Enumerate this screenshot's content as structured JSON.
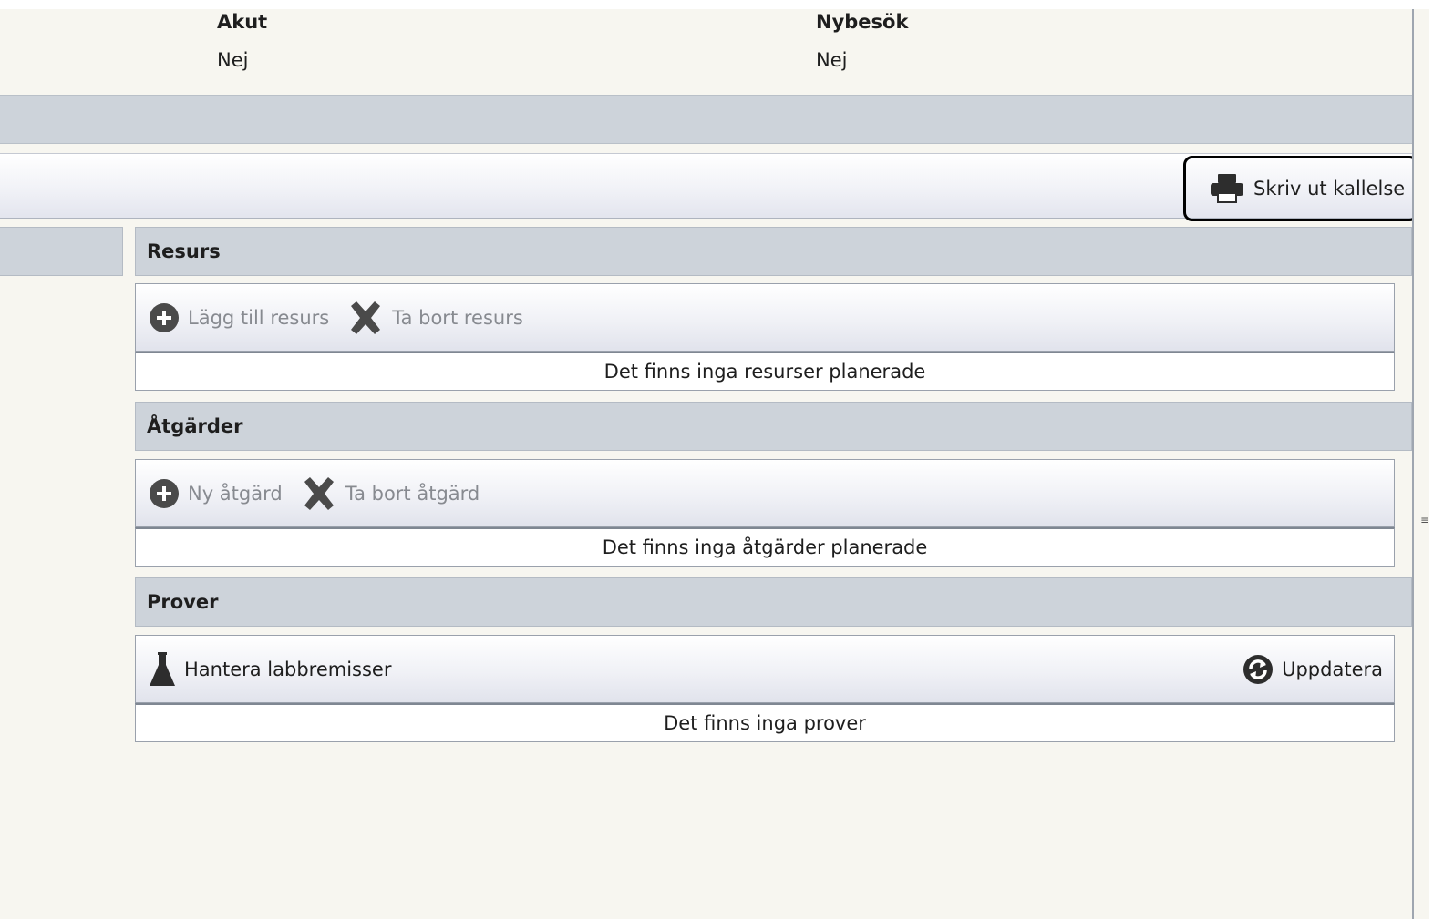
{
  "info": {
    "akut_label": "Akut",
    "akut_value": "Nej",
    "nybesok_label": "Nybesök",
    "nybesok_value": "Nej"
  },
  "toolbar": {
    "print_label": "Skriv ut kallelse",
    "print_icon": "printer-icon"
  },
  "sections": {
    "resurs": {
      "title": "Resurs",
      "add_label": "Lägg till resurs",
      "remove_label": "Ta bort resurs",
      "empty_text": "Det finns inga resurser planerade"
    },
    "atgarder": {
      "title": "Åtgärder",
      "add_label": "Ny åtgärd",
      "remove_label": "Ta bort åtgärd",
      "empty_text": "Det finns inga åtgärder planerade"
    },
    "prover": {
      "title": "Prover",
      "manage_label": "Hantera labbremisser",
      "refresh_label": "Uppdatera",
      "empty_text": "Det finns inga prover"
    }
  },
  "colors": {
    "header_bg": "#cdd3da",
    "background": "#f7f6f0",
    "disabled_text": "#878a90",
    "icon_gray": "#2d2d2d"
  }
}
